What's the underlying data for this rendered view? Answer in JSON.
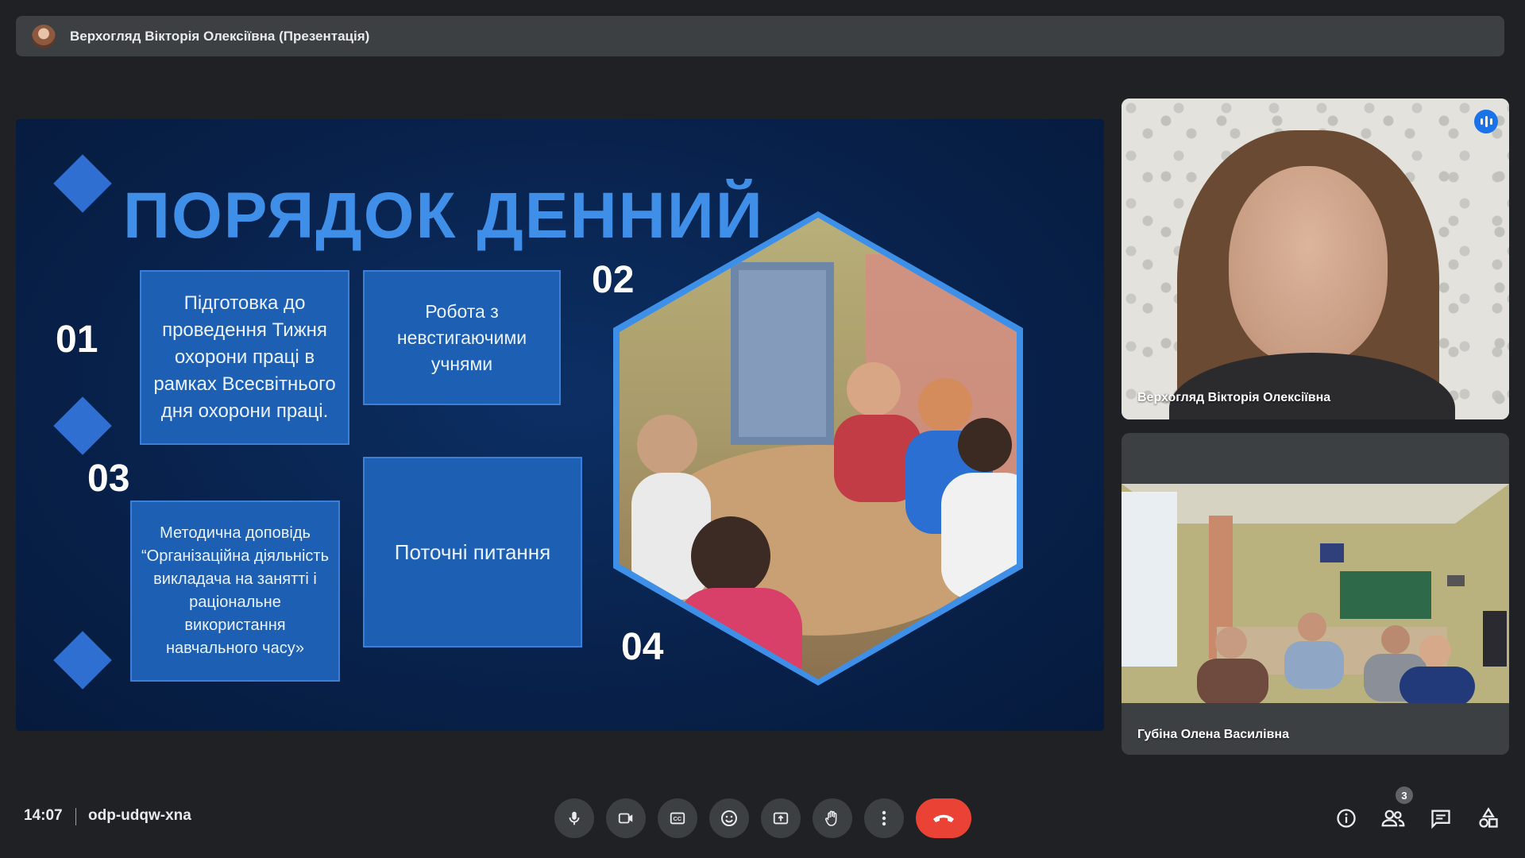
{
  "presenting_bar": {
    "title": "Верхогляд Вікторія Олексіївна (Презентація)"
  },
  "slide": {
    "title": "ПОРЯДОК ДЕННИЙ",
    "numbers": [
      "01",
      "02",
      "03",
      "04"
    ],
    "items": [
      "Підготовка до проведення Тижня охорони праці в рамках Всесвітнього дня охорони праці.",
      "Робота з невстигаючими учнями",
      "Методична доповідь “Організаційна діяльність викладача на занятті і раціональне використання навчального часу»",
      "Поточні питання"
    ]
  },
  "participants": [
    {
      "name": "Верхогляд Вікторія Олексіївна",
      "speaking": true
    },
    {
      "name": "Губіна Олена Василівна",
      "speaking": false
    }
  ],
  "meeting": {
    "time": "14:07",
    "code": "odp-udqw-xna",
    "participant_count": "3"
  },
  "controls": [
    "mic-icon",
    "camera-icon",
    "captions-icon",
    "emoji-icon",
    "present-icon",
    "raise-hand-icon",
    "more-options-icon",
    "end-call-icon"
  ],
  "right_controls": [
    "info-icon",
    "people-icon",
    "chat-icon",
    "activities-icon"
  ],
  "colors": {
    "end_call": "#ea4335",
    "speaking_accent": "#8ab4f8",
    "slide_title": "#3f8ee8",
    "background": "#202124"
  }
}
